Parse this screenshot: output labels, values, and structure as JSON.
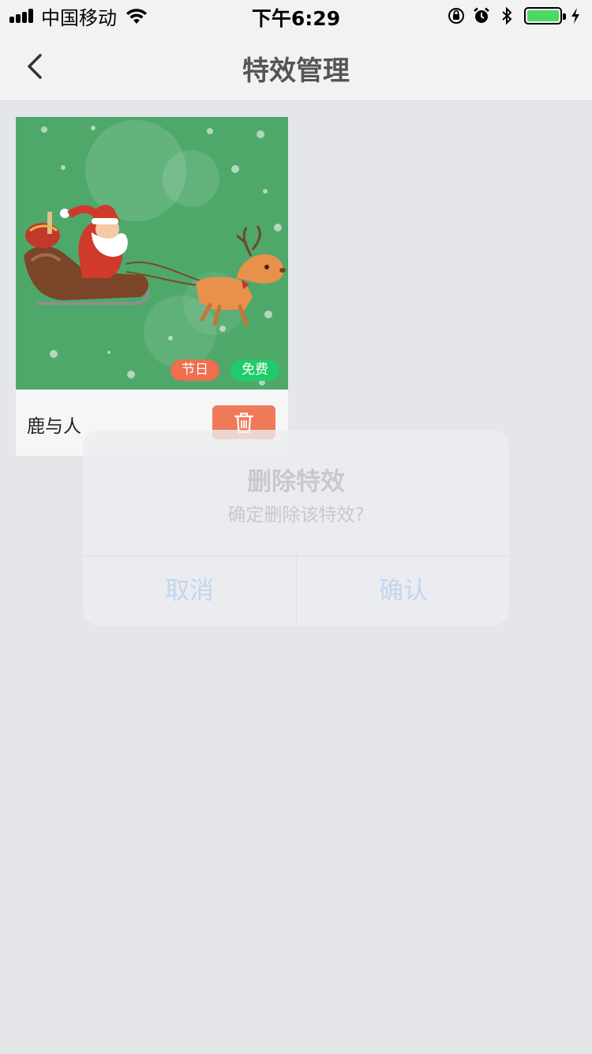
{
  "status_bar": {
    "carrier": "中国移动",
    "time": "下午6:29",
    "battery_level": 1.0,
    "icons": [
      "signal-icon",
      "wifi-icon",
      "orientation-lock-icon",
      "alarm-icon",
      "bluetooth-icon",
      "battery-icon",
      "charging-icon"
    ]
  },
  "nav": {
    "title": "特效管理",
    "back_icon": "chevron-left-icon"
  },
  "effects": [
    {
      "name": "鹿与人",
      "tags": [
        "节日",
        "免费"
      ],
      "delete_icon": "trash-icon"
    }
  ],
  "dialog": {
    "title": "删除特效",
    "message": "确定删除该特效?",
    "cancel_label": "取消",
    "confirm_label": "确认"
  },
  "colors": {
    "background": "#e5e6ea",
    "bar": "#f2f2f2",
    "thumb_green": "#4ea86a",
    "tag_holiday": "#ee6e4e",
    "tag_free": "#1fcb6a",
    "delete_button": "#ef7a5a",
    "battery": "#4cd964"
  }
}
